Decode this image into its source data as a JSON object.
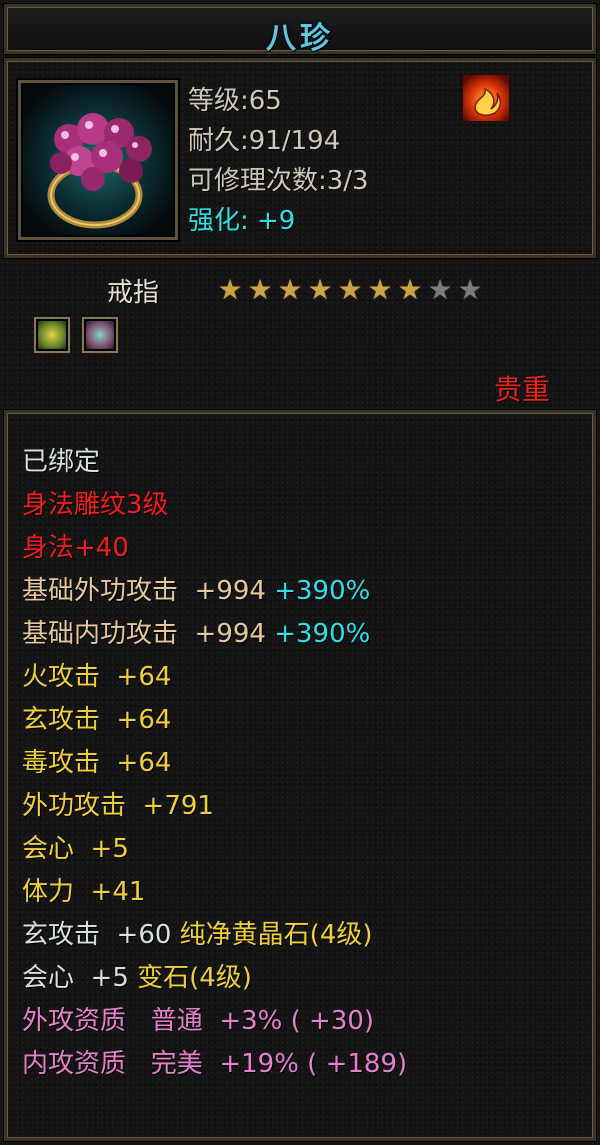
{
  "item": {
    "name": "八珍",
    "level_label": "等级:65",
    "durability_label": "耐久:91/194",
    "repair_label": "可修理次数:3/3",
    "enhance_label": "强化: +9",
    "type": "戒指",
    "rarity": "贵重",
    "stars": {
      "filled": 7,
      "total": 9
    }
  },
  "colors": {
    "title": "#5fc6e6",
    "enhance": "#2fe0e6",
    "rarity": "#e8261c",
    "star_on": "#c9a547",
    "star_off": "#7c7c7c"
  },
  "icons": {
    "item_icon": "ring-with-purple-pearls-icon",
    "element_icon": "fire-element-icon",
    "sockets": [
      "yellow-gem-socket-icon",
      "gray-gem-socket-icon"
    ]
  },
  "attributes": {
    "bound": "已绑定",
    "engraving": "身法雕纹3级",
    "agility": "身法+40",
    "base_outer": {
      "label": "基础外功攻击  +994 ",
      "pct": "+390%"
    },
    "base_inner": {
      "label": "基础内功攻击  +994 ",
      "pct": "+390%"
    },
    "fire": "火攻击  +64",
    "mystic": "玄攻击  +64",
    "poison": "毒攻击  +64",
    "outer": "外功攻击  +791",
    "crit": "会心  +5",
    "stamina": "体力  +41",
    "gem_mystic": {
      "stat": "玄攻击  +60 ",
      "gem": "纯净黄晶石(4级)"
    },
    "gem_crit": {
      "stat": "会心  +5 ",
      "gem": "变石(4级)"
    },
    "outer_quality": "外攻资质   普通  +3% ( +30)",
    "inner_quality": "内攻资质   完美  +19% ( +189)"
  }
}
